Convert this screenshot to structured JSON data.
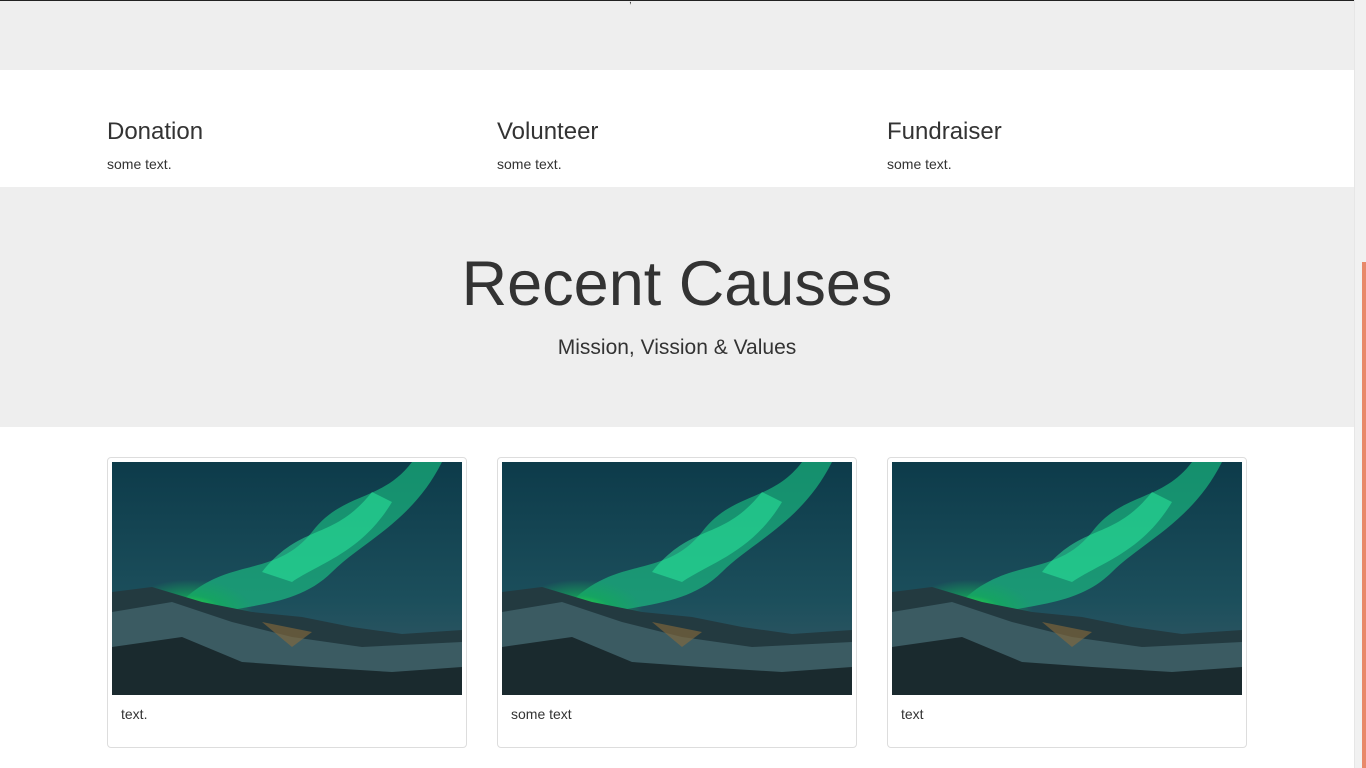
{
  "top_band": {
    "stray_text": ","
  },
  "services": [
    {
      "title": "Donation",
      "text": "some text."
    },
    {
      "title": "Volunteer",
      "text": "some text."
    },
    {
      "title": "Fundraiser",
      "text": "some text."
    }
  ],
  "banner": {
    "title": "Recent Causes",
    "subtitle": "Mission, Vission & Values"
  },
  "cards": [
    {
      "caption": "text.",
      "image": "aurora-landscape"
    },
    {
      "caption": "some text",
      "image": "aurora-landscape"
    },
    {
      "caption": "text",
      "image": "aurora-landscape"
    }
  ],
  "colors": {
    "section_grey": "#eeeeee",
    "text": "#333333",
    "scroll_accent": "#e8896a"
  }
}
